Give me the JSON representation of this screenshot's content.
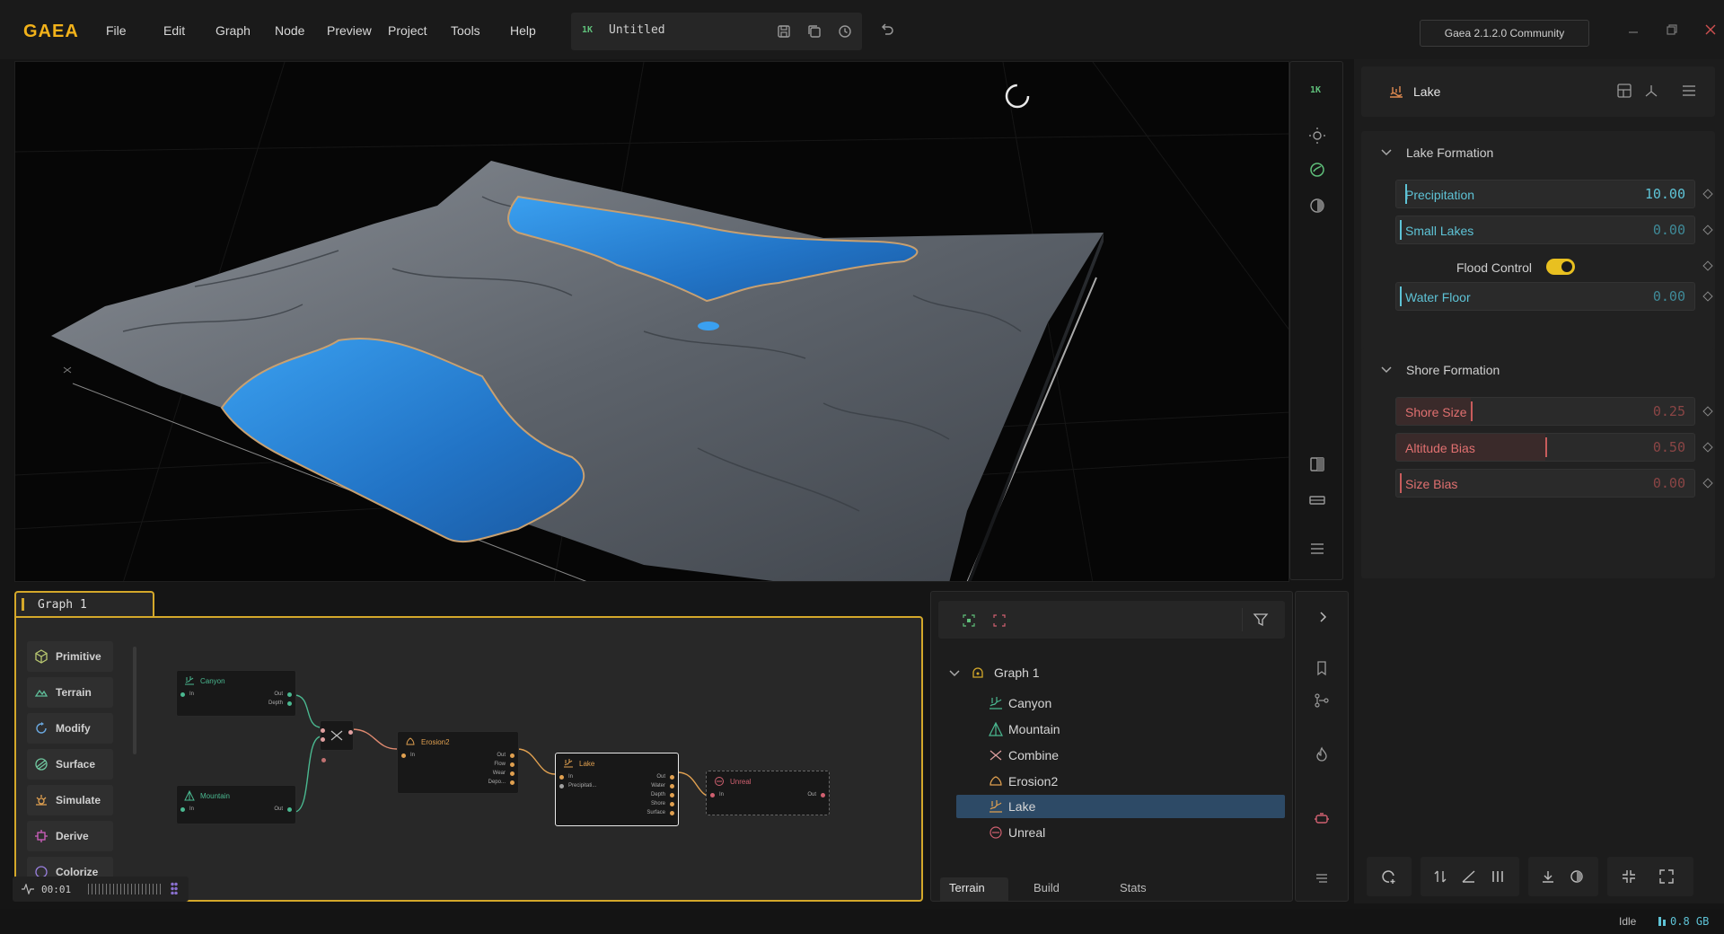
{
  "app": {
    "logo": "GAEA",
    "version": "Gaea 2.1.2.0 Community"
  },
  "menu": [
    "File",
    "Edit",
    "Graph",
    "Node",
    "Preview",
    "Project",
    "Tools",
    "Help"
  ],
  "file": {
    "resolution": "1K",
    "name": "Untitled"
  },
  "viewport": {
    "resolution_badge": "1K"
  },
  "properties": {
    "node_name": "Lake",
    "sections": [
      {
        "title": "Lake Formation",
        "params": [
          {
            "label": "Precipitation",
            "value": "10.00",
            "level": 0.0
          },
          {
            "label": "Small Lakes",
            "value": "0.00",
            "level": 0.0
          },
          {
            "label": "Flood Control",
            "type": "toggle",
            "on": true
          },
          {
            "label": "Water Floor",
            "value": "0.00",
            "level": 0.0
          }
        ]
      },
      {
        "title": "Shore Formation",
        "params": [
          {
            "label": "Shore Size",
            "value": "0.25",
            "level": 0.25
          },
          {
            "label": "Altitude Bias",
            "value": "0.50",
            "level": 0.5
          },
          {
            "label": "Size Bias",
            "value": "0.00",
            "level": 0.0
          }
        ]
      }
    ]
  },
  "graph": {
    "tab": "Graph 1",
    "categories": [
      "Primitive",
      "Terrain",
      "Modify",
      "Surface",
      "Simulate",
      "Derive",
      "Colorize"
    ],
    "timer": "00:01",
    "nodes": {
      "canyon": {
        "title": "Canyon",
        "in": "In",
        "outs": [
          "Out",
          "Depth"
        ]
      },
      "mountain": {
        "title": "Mountain",
        "in": "In",
        "outs": [
          "Out"
        ]
      },
      "erosion2": {
        "title": "Erosion2",
        "in": "In",
        "outs": [
          "Out",
          "Flow",
          "Wear",
          "Depo..."
        ]
      },
      "lake": {
        "title": "Lake",
        "ins": [
          "In",
          "Precipitati..."
        ],
        "outs": [
          "Out",
          "Water",
          "Depth",
          "Shore",
          "Surface"
        ]
      },
      "unreal": {
        "title": "Unreal",
        "in": "In",
        "outs": [
          "Out"
        ]
      }
    }
  },
  "tree": {
    "root": "Graph 1",
    "items": [
      "Canyon",
      "Mountain",
      "Combine",
      "Erosion2",
      "Lake",
      "Unreal"
    ],
    "selected": "Lake",
    "tabs": [
      "Terrain",
      "Build",
      "Stats"
    ]
  },
  "status": {
    "state": "Idle",
    "memory": "0.8 GB"
  },
  "colors": {
    "accent": "#d4a82a",
    "water": "#2e8fe0",
    "selection": "#2d4a66",
    "cyan": "#5ec3d6",
    "red": "#c85c5c"
  }
}
